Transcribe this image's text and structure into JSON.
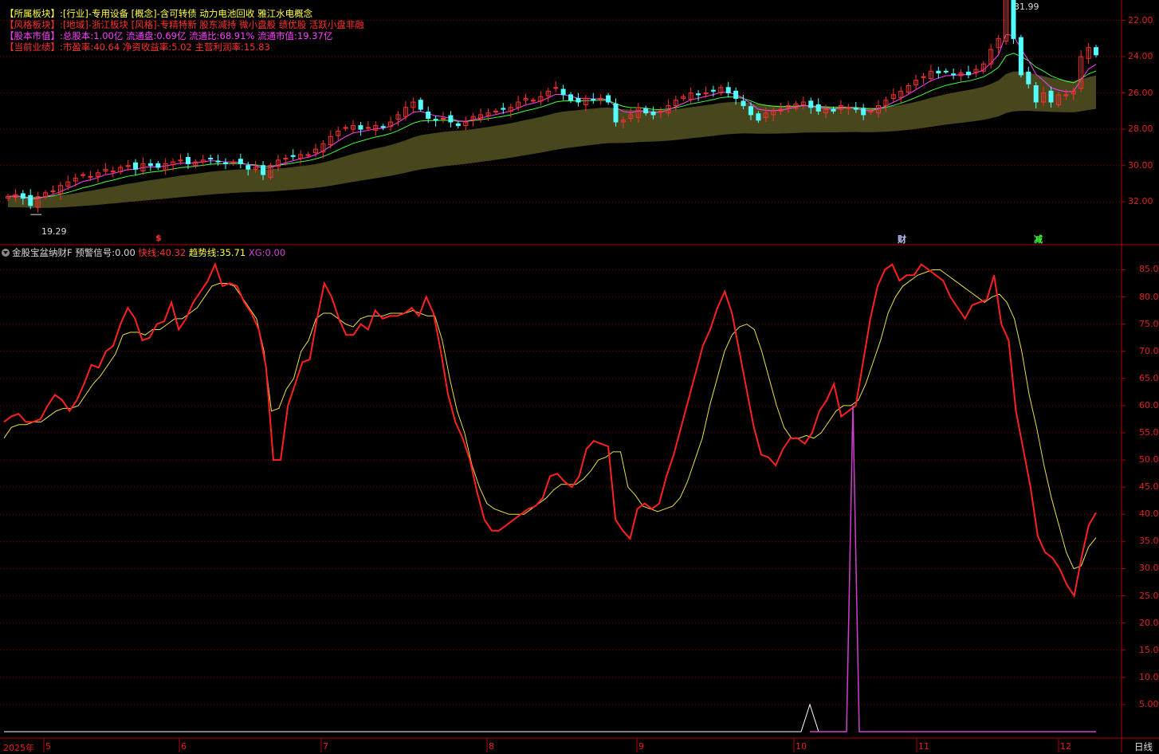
{
  "info_panel": {
    "rows": [
      {
        "label": "【所属板块】:",
        "value": "[行业]-专用设备 [概念]-含可转债 动力电池回收 雅江水电概念",
        "label_color": "#ffff40",
        "value_color": "#ffff40"
      },
      {
        "label": "【风格板块】:",
        "value": "[地域]-浙江板块 [风格]-专精特新 股东减持 微小盘股 绩优股 活跃小盘非融",
        "label_color": "#ff3030",
        "value_color": "#ff3030"
      },
      {
        "label": "【股本市值】:",
        "value": "总股本:1.00亿 流通盘:0.69亿 流通比:68.91% 流通市值:19.37亿",
        "label_color": "#ff40ff",
        "value_color": "#ff40ff"
      },
      {
        "label": "【当前业绩】:",
        "value": "市盈率:40.64 净资收益率:5.02 主营利润率:15.83",
        "label_color": "#ff3030",
        "value_color": "#ff3030"
      }
    ]
  },
  "price_panel": {
    "high_label": "31.99",
    "low_label": "19.29",
    "y_ticks": [
      "32.00",
      "30.00",
      "28.00",
      "26.00",
      "24.00",
      "22.00",
      "20.00"
    ],
    "markers": [
      {
        "text": "$",
        "color": "#ff3030"
      },
      {
        "text": "财",
        "color": "#c0c0ff"
      },
      {
        "text": "减",
        "color": "#40ff40"
      }
    ]
  },
  "indicator": {
    "name": "金股宝盆纳财F",
    "signal_label": "预警信号:",
    "signal_value": "0.00",
    "fast_label": "快线:",
    "fast_value": "40.32",
    "trend_label": "趋势线:",
    "trend_value": "35.71",
    "xg_label": "XG:",
    "xg_value": "0.00",
    "y_ticks": [
      "85.00",
      "80.00",
      "75.00",
      "70.00",
      "65.00",
      "60.00",
      "55.00",
      "50.00",
      "45.00",
      "40.00",
      "35.00",
      "30.00",
      "25.00",
      "20.00",
      "15.00",
      "10.00",
      "5.00"
    ]
  },
  "x_axis": {
    "labels": [
      "2025年",
      "5",
      "6",
      "7",
      "8",
      "9",
      "10",
      "11",
      "12"
    ],
    "period": "日线"
  },
  "colors": {
    "up": "#ff3030",
    "down": "#54ffff",
    "band": "#4b4a1e",
    "ma_fast": "#ff40ff",
    "ma_slow": "#40ff40",
    "fast_line": "#ff2020",
    "trend_line": "#e8e050",
    "xg_line": "#d040d0",
    "signal_line": "#ffffff",
    "grid": "#8a0000"
  },
  "chart_data": [
    {
      "type": "candlestick",
      "title": "",
      "ylim": [
        19,
        32
      ],
      "y_ticks": [
        20,
        22,
        24,
        26,
        28,
        30,
        32
      ],
      "high": 31.99,
      "low": 19.29,
      "close_series": [
        20.3,
        20.4,
        20.2,
        19.8,
        20.3,
        20.5,
        20.6,
        20.9,
        21.1,
        21.3,
        21.5,
        21.4,
        21.6,
        21.8,
        21.7,
        21.9,
        22.0,
        21.8,
        22.1,
        22.0,
        21.9,
        22.1,
        22.2,
        22.3,
        22.1,
        22.2,
        22.3,
        22.4,
        22.2,
        22.1,
        22.2,
        22.1,
        21.8,
        21.9,
        21.5,
        22.0,
        22.3,
        22.4,
        22.5,
        22.6,
        22.6,
        22.9,
        23.2,
        23.6,
        23.9,
        24.1,
        24.2,
        24.0,
        24.1,
        24.2,
        24.1,
        24.4,
        24.8,
        25.2,
        25.5,
        25.1,
        24.6,
        24.5,
        24.6,
        24.4,
        24.2,
        24.4,
        24.7,
        24.8,
        24.9,
        25.0,
        25.1,
        25.2,
        25.5,
        25.7,
        25.6,
        25.8,
        26.1,
        26.3,
        25.9,
        25.6,
        25.5,
        25.7,
        25.6,
        25.7,
        25.5,
        24.4,
        24.5,
        24.8,
        25.2,
        24.9,
        24.8,
        25.0,
        25.3,
        25.6,
        25.8,
        26.0,
        25.9,
        26.0,
        26.1,
        26.3,
        26.0,
        25.7,
        25.3,
        24.8,
        24.5,
        24.9,
        25.0,
        25.1,
        25.3,
        25.4,
        25.5,
        25.2,
        25.0,
        25.1,
        25.0,
        25.3,
        25.2,
        25.1,
        24.8,
        25.0,
        25.3,
        25.6,
        25.9,
        26.1,
        26.4,
        26.7,
        26.9,
        27.2,
        27.1,
        27.2,
        27.0,
        27.1,
        27.0,
        27.3,
        27.6,
        28.4,
        29.0,
        31.5,
        29.0,
        27.0,
        26.5,
        25.5,
        26.0,
        25.5,
        25.9,
        25.9,
        26.1,
        28.0,
        28.5,
        28.1
      ]
    },
    {
      "type": "line",
      "title": "",
      "ylim": [
        0,
        88
      ],
      "y_ticks": [
        5,
        10,
        15,
        20,
        25,
        30,
        35,
        40,
        45,
        50,
        55,
        60,
        65,
        70,
        75,
        80,
        85
      ],
      "series": [
        {
          "name": "快线",
          "values": [
            57,
            58,
            58.5,
            57,
            57,
            57.5,
            60,
            62,
            61,
            59,
            61,
            64,
            67.5,
            67,
            70,
            71,
            75,
            78,
            76,
            72,
            72.5,
            75,
            75.5,
            79,
            74,
            76,
            79,
            81,
            83,
            86,
            82,
            82.5,
            82,
            79,
            77,
            74,
            67,
            50,
            50,
            60,
            64,
            68,
            68.5,
            76,
            82.5,
            80,
            76,
            73,
            73,
            75,
            74,
            77.5,
            76,
            76.5,
            76.5,
            77,
            78,
            76.5,
            80,
            77,
            70,
            62,
            57,
            54,
            50,
            44,
            39,
            37,
            37,
            38,
            39,
            40,
            41,
            41.5,
            43,
            47,
            47.5,
            46,
            45,
            47,
            52,
            53.5,
            53,
            52.5,
            39,
            37,
            35.5,
            41,
            42,
            41,
            42,
            47,
            51,
            56,
            61,
            66,
            71,
            74,
            78,
            81,
            77,
            70,
            63,
            56,
            51,
            50.5,
            49,
            52,
            54,
            54,
            53,
            55,
            59,
            61,
            64,
            58,
            59,
            60,
            68,
            76,
            82,
            85,
            86,
            83,
            84,
            84,
            86,
            85,
            84,
            83,
            80,
            78,
            76,
            78.5,
            79,
            79.5,
            84,
            75,
            72,
            59,
            52,
            45,
            36,
            33,
            32,
            30,
            27,
            25,
            32,
            38,
            40.32
          ]
        },
        {
          "name": "趋势线",
          "values": [
            54,
            56,
            56.5,
            56.5,
            57,
            57,
            58,
            59,
            59.5,
            59.5,
            60,
            62,
            64,
            65.5,
            67.5,
            69.5,
            73,
            73.5,
            73.5,
            73,
            74,
            74,
            75,
            76,
            76,
            77,
            78,
            80,
            82,
            82.5,
            82.5,
            82,
            80,
            78,
            76,
            70,
            59,
            59.5,
            63,
            65,
            70,
            72,
            76,
            77,
            77,
            76,
            75,
            74.5,
            76,
            76.5,
            76.5,
            76.5,
            77,
            77,
            77,
            77.5,
            77,
            76.5,
            76.5,
            72,
            65,
            59,
            55,
            49,
            45,
            42,
            41,
            40.5,
            40,
            40,
            40,
            41,
            42,
            43,
            44.5,
            45.5,
            45.5,
            45.5,
            46.5,
            48,
            50,
            50.5,
            51.5,
            51.5,
            45,
            43.5,
            41.5,
            41,
            40.5,
            41,
            41.5,
            43,
            46,
            50,
            54,
            60,
            65,
            70,
            73,
            74.5,
            75,
            74,
            70,
            65,
            60,
            56,
            54,
            54,
            54.5,
            54,
            55,
            57,
            59,
            60,
            60,
            61,
            64,
            68,
            72,
            77,
            80,
            82,
            83,
            84,
            84.5,
            85,
            85,
            84,
            83,
            82,
            81,
            80,
            79,
            80,
            80.5,
            79,
            76,
            70,
            62,
            56,
            49,
            43,
            38,
            33,
            30,
            30.5,
            34,
            35.71
          ]
        }
      ]
    }
  ]
}
